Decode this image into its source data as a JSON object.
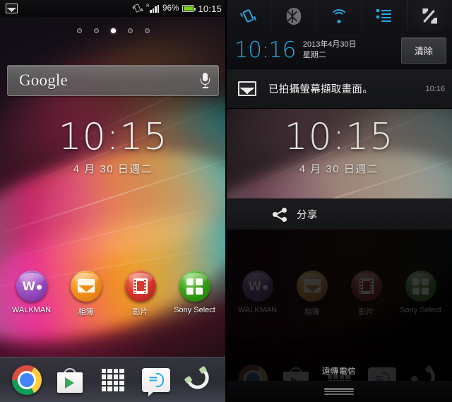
{
  "left": {
    "status_bar": {
      "notification_icon": "photo-icon",
      "vibrate_icon": "vibrate-icon",
      "roaming_indicator": "R",
      "signal_icon": "signal-bars-icon",
      "battery_percent": "96%",
      "battery_icon": "battery-icon",
      "battery_color": "#7ed321",
      "clock": "10:15"
    },
    "page_indicator": {
      "count": 5,
      "active_index": 2
    },
    "search_widget": {
      "label": "Google",
      "mic_icon": "microphone-icon"
    },
    "clock_widget": {
      "time": "10:15",
      "date": "4 月 30 日週二"
    },
    "apps": [
      {
        "label": "WALKMAN",
        "icon": "walkman-icon",
        "color": "#9b4fc4"
      },
      {
        "label": "相簿",
        "icon": "album-icon",
        "color": "#f5921e"
      },
      {
        "label": "影片",
        "icon": "movies-icon",
        "color": "#d8392b"
      },
      {
        "label": "Sony Select",
        "icon": "sony-select-icon",
        "color": "#37a315"
      }
    ],
    "dock": [
      {
        "name": "chrome-icon"
      },
      {
        "name": "play-store-icon"
      },
      {
        "name": "app-drawer-icon"
      },
      {
        "name": "messaging-icon"
      },
      {
        "name": "phone-icon"
      }
    ]
  },
  "right": {
    "quick_settings": [
      {
        "name": "vibrate-toggle",
        "icon": "vibrate-icon",
        "state": "on",
        "color": "#29a9e1"
      },
      {
        "name": "bluetooth-toggle",
        "icon": "bluetooth-icon",
        "state": "off",
        "color": "#6d6f72"
      },
      {
        "name": "wifi-toggle",
        "icon": "wifi-icon",
        "state": "on",
        "color": "#29a9e1"
      },
      {
        "name": "data-toggle",
        "icon": "data-transfer-icon",
        "state": "on",
        "color": "#29a9e1"
      },
      {
        "name": "settings-button",
        "icon": "tools-icon",
        "state": "off",
        "color": "#cfd1d3"
      }
    ],
    "header": {
      "time": "10:16",
      "date": "2013年4月30日",
      "weekday": "星期二",
      "clear_label": "清除",
      "time_color": "#29a9e1"
    },
    "notification": {
      "icon": "photo-icon",
      "text": "已拍攝螢幕擷取畫面。",
      "time": "10:16"
    },
    "preview": {
      "clock": "10:15",
      "date": "4 月 30 日週二"
    },
    "share_action": {
      "icon": "share-icon",
      "label": "分享"
    },
    "carrier": "遠傳電信",
    "drag_handle": "drag-handle"
  }
}
